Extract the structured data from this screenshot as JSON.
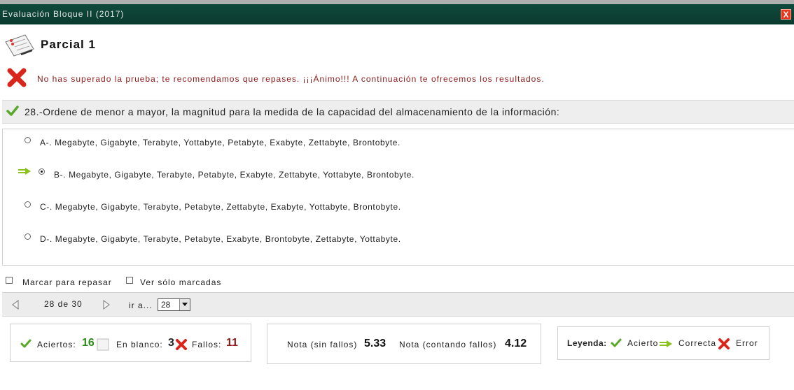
{
  "window": {
    "title": "Evaluación Bloque II (2017)",
    "close_label": "X"
  },
  "header": {
    "title": "Parcial 1"
  },
  "result": {
    "message": "No has superado la prueba; te recomendamos que repases. ¡¡¡Ánimo!!! A continuación te ofrecemos los resultados."
  },
  "question": {
    "text": "28.-Ordene de menor a mayor, la magnitud para la medida de la capacidad del almacenamiento de la información:",
    "answers": [
      {
        "label": "A-. Megabyte, Gigabyte, Terabyte, Yottabyte, Petabyte, Exabyte, Zettabyte, Brontobyte.",
        "selected": false
      },
      {
        "label": "B-. Megabyte, Gigabyte, Terabyte, Petabyte, Exabyte, Zettabyte, Yottabyte, Brontobyte.",
        "selected": true
      },
      {
        "label": "C-. Megabyte, Gigabyte, Terabyte, Petabyte, Zettabyte, Exabyte, Yottabyte, Brontobyte.",
        "selected": false
      },
      {
        "label": "D-. Megabyte, Gigabyte, Terabyte, Petabyte, Exabyte, Brontobyte, Zettabyte, Yottabyte.",
        "selected": false
      }
    ]
  },
  "options": {
    "mark_review": "Marcar para repasar",
    "show_marked": "Ver sólo marcadas"
  },
  "pagination": {
    "position": "28 de 30",
    "goto_label": "ir a...",
    "goto_value": "28"
  },
  "summary": {
    "aciertos_label": "Aciertos:",
    "aciertos_value": "16",
    "blanco_label": "En blanco:",
    "blanco_value": "3",
    "fallos_label": "Fallos:",
    "fallos_value": "11",
    "nota_sin_label": "Nota (sin fallos)",
    "nota_sin_value": "5.33",
    "nota_con_label": "Nota (contando fallos)",
    "nota_con_value": "4.12",
    "legend_label": "Leyenda:",
    "legend_acierto": "Acierto",
    "legend_correcta": "Correcta",
    "legend_error": "Error"
  },
  "colors": {
    "titlebar": "#0f4a3c",
    "success_green": "#2a8a1a",
    "fail_red": "#8b1a1a",
    "error_icon": "#d9261c",
    "check_green": "#5aa82a",
    "arrow_green": "#8cc21a"
  },
  "icons": [
    "exam-paper-icon",
    "error-x-icon",
    "check-icon",
    "arrow-right-icon",
    "blank-box-icon",
    "prev-arrow-icon",
    "next-arrow-icon"
  ]
}
